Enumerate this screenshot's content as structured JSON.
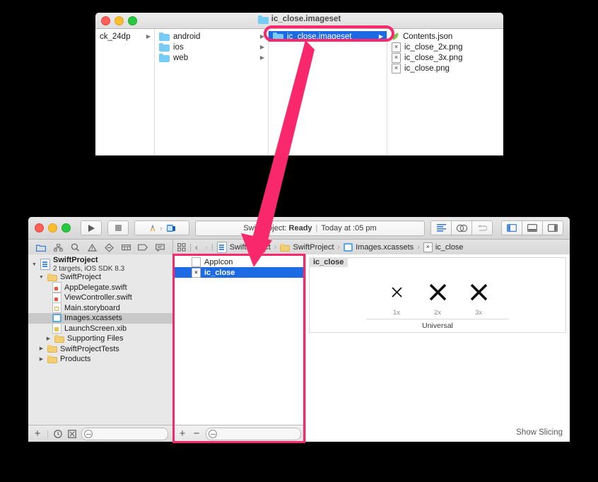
{
  "finder": {
    "title": "ic_close.imageset",
    "title_icon": "folder-icon",
    "columns": [
      {
        "name": "source-column",
        "rows": [
          {
            "label": "ck_24dp",
            "icon": "none",
            "chevron": true,
            "selected": false
          }
        ]
      },
      {
        "name": "platform-column",
        "rows": [
          {
            "label": "android",
            "icon": "folder-icon",
            "chevron": true,
            "selected": false
          },
          {
            "label": "ios",
            "icon": "folder-icon",
            "chevron": true,
            "selected": false
          },
          {
            "label": "web",
            "icon": "folder-icon",
            "chevron": true,
            "selected": false
          }
        ]
      },
      {
        "name": "imageset-column",
        "rows": [
          {
            "label": "ic_close.imageset",
            "icon": "folder-icon",
            "chevron": true,
            "selected": true
          }
        ]
      },
      {
        "name": "contents-column",
        "rows": [
          {
            "label": "Contents.json",
            "icon": "leaf-icon",
            "chevron": false,
            "selected": false
          },
          {
            "label": "ic_close_2x.png",
            "icon": "png-icon",
            "chevron": false,
            "selected": false
          },
          {
            "label": "ic_close_3x.png",
            "icon": "png-icon",
            "chevron": false,
            "selected": false
          },
          {
            "label": "ic_close.png",
            "icon": "png-icon",
            "chevron": false,
            "selected": false
          }
        ]
      }
    ]
  },
  "xcode": {
    "toolbar": {
      "run_icon": "play-icon",
      "stop_icon": "stop-icon",
      "scheme_icon": "xcode-scheme-icon",
      "destination_icon": "simulator-icon",
      "status": {
        "project": "SwiftProject:",
        "state": "Ready",
        "separator": "|",
        "time": "Today at  :05 pm"
      },
      "editor_buttons": [
        "standard-editor-icon",
        "assistant-editor-icon",
        "version-editor-icon"
      ],
      "view_buttons": [
        "toggle-navigator-icon",
        "toggle-debug-area-icon",
        "toggle-utilities-icon"
      ]
    },
    "navigator_tabs": [
      "project-navigator-icon",
      "symbol-navigator-icon",
      "find-navigator-icon",
      "issue-navigator-icon",
      "test-navigator-icon",
      "debug-navigator-icon",
      "breakpoint-navigator-icon",
      "report-navigator-icon"
    ],
    "jumpbar": {
      "grid_icon": "related-items-icon",
      "back_icon": "chevron-left-icon",
      "forward_icon": "chevron-right-icon",
      "crumbs": [
        {
          "label": "SwiftProject",
          "icon": "project-icon"
        },
        {
          "label": "SwiftProject",
          "icon": "folder-icon"
        },
        {
          "label": "Images.xcassets",
          "icon": "xcassets-icon"
        },
        {
          "label": "ic_close",
          "icon": "imageset-icon"
        }
      ]
    },
    "navigator_tree": [
      {
        "depth": 0,
        "twisty": "down",
        "icon": "project-icon",
        "label": "SwiftProject",
        "sublabel": "2 targets, iOS SDK 8.3",
        "selected": false
      },
      {
        "depth": 1,
        "twisty": "down",
        "icon": "folder-icon",
        "label": "SwiftProject",
        "selected": false
      },
      {
        "depth": 2,
        "twisty": "none",
        "icon": "swift-icon",
        "label": "AppDelegate.swift",
        "selected": false
      },
      {
        "depth": 2,
        "twisty": "none",
        "icon": "swift-icon",
        "label": "ViewController.swift",
        "selected": false
      },
      {
        "depth": 2,
        "twisty": "none",
        "icon": "storyboard-icon",
        "label": "Main.storyboard",
        "selected": false
      },
      {
        "depth": 2,
        "twisty": "none",
        "icon": "xcassets-icon",
        "label": "Images.xcassets",
        "selected": true
      },
      {
        "depth": 2,
        "twisty": "none",
        "icon": "xib-icon",
        "label": "LaunchScreen.xib",
        "selected": false
      },
      {
        "depth": 1,
        "twisty": "right",
        "icon": "folder-icon",
        "label": "Supporting Files",
        "selected": false
      },
      {
        "depth": 0,
        "twisty": "right",
        "icon": "folder-icon",
        "label": "SwiftProjectTests",
        "selected": false
      },
      {
        "depth": 0,
        "twisty": "right",
        "icon": "folder-icon",
        "label": "Products",
        "selected": false
      }
    ],
    "navigator_bottom": {
      "add_icon": "plus-icon",
      "recent_icon": "clock-icon",
      "filter_icon": "source-control-filter-icon",
      "search_placeholder": ""
    },
    "asset_list": [
      {
        "label": "AppIcon",
        "icon": "appicon-icon",
        "selected": false
      },
      {
        "label": "ic_close",
        "icon": "imageset-icon",
        "selected": true
      }
    ],
    "asset_bottom": {
      "add_label": "+",
      "remove_label": "−",
      "search_placeholder": ""
    },
    "editor": {
      "slot_title": "ic_close",
      "icons": [
        {
          "scale": "1x",
          "glyph": "close-x-icon",
          "size": 17
        },
        {
          "scale": "2x",
          "glyph": "close-x-icon",
          "size": 26
        },
        {
          "scale": "3x",
          "glyph": "close-x-icon",
          "size": 26
        }
      ],
      "device_label": "Universal",
      "show_slicing_label": "Show Slicing"
    }
  },
  "annotations": {
    "accent_color": "#f9276b",
    "highlight_pill": {
      "name": "finder-imageset-highlight"
    },
    "highlight_rect": {
      "name": "asset-list-highlight"
    },
    "arrow": {
      "name": "pointer-arrow"
    }
  }
}
